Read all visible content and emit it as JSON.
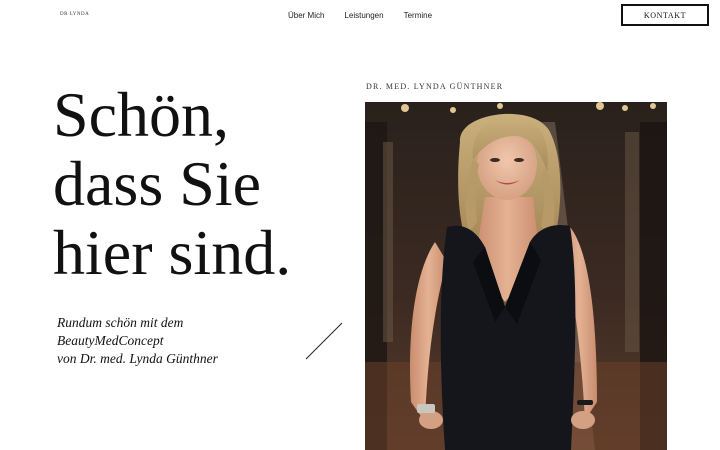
{
  "header": {
    "logo_text": "DR LYNDA",
    "nav": [
      "Über Mich",
      "Leistungen",
      "Termine"
    ],
    "cta_label": "KONTAKT"
  },
  "hero": {
    "headline": [
      "Schön,",
      "dass Sie",
      "hier sind."
    ],
    "subline": [
      "Rundum schön mit dem",
      "BeautyMedConcept",
      "von Dr. med. Lynda Günthner"
    ],
    "photo_caption": "DR. MED. LYNDA GÜNTHNER"
  },
  "colors": {
    "text": "#111111",
    "background": "#ffffff"
  }
}
